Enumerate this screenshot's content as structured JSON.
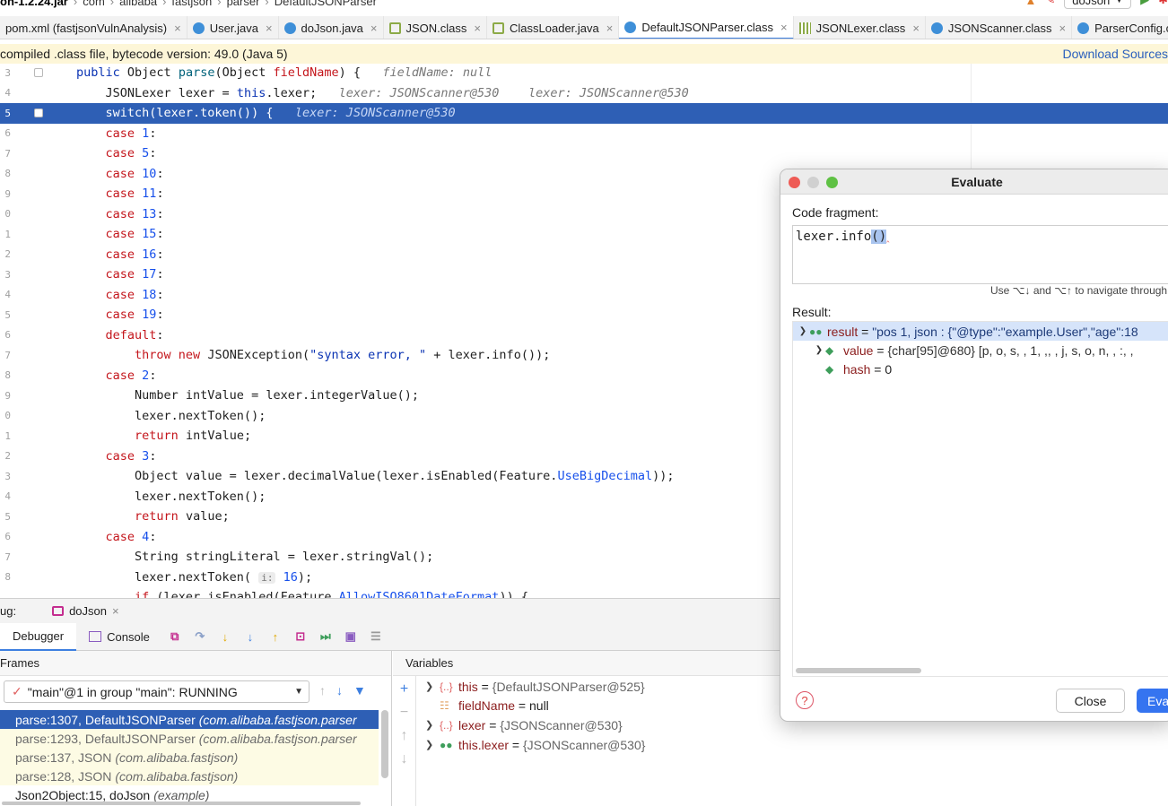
{
  "breadcrumb": {
    "items": [
      "on-1.2.24.jar",
      "com",
      "alibaba",
      "fastjson",
      "parser",
      "DefaultJSONParser"
    ]
  },
  "run_config": {
    "label": "doJson"
  },
  "tabs": [
    {
      "label": "pom.xml (fastjsonVulnAnalysis)",
      "icon": "xml-icon"
    },
    {
      "label": "User.java",
      "icon": "java-icon"
    },
    {
      "label": "doJson.java",
      "icon": "java-icon"
    },
    {
      "label": "JSON.class",
      "icon": "class-icon"
    },
    {
      "label": "ClassLoader.java",
      "icon": "class-icon"
    },
    {
      "label": "DefaultJSONParser.class",
      "icon": "java-icon"
    },
    {
      "label": "JSONLexer.class",
      "icon": "interface-icon"
    },
    {
      "label": "JSONScanner.class",
      "icon": "java-icon"
    },
    {
      "label": "ParserConfig.class",
      "icon": "java-icon"
    }
  ],
  "notice": {
    "text": "compiled .class file, bytecode version: 49.0 (Java 5)",
    "link": "Download Sources"
  },
  "editor": {
    "line_numbers": [
      "3",
      "4",
      "5",
      "6",
      "7",
      "8",
      "9",
      "0",
      "1",
      "2",
      "3",
      "4",
      "5",
      "6",
      "7",
      "8",
      "9",
      "0",
      "1",
      "2",
      "3",
      "4",
      "5",
      "6",
      "7",
      "8"
    ],
    "hints": {
      "l0": "fieldName: null",
      "l1a": "lexer: JSONScanner@530",
      "l1b": "lexer: JSONScanner@530",
      "l2": "lexer: JSONScanner@530",
      "param": "i:"
    }
  },
  "debug": {
    "label": "ug:",
    "session": "doJson",
    "tabs": {
      "debugger": "Debugger",
      "console": "Console"
    },
    "frames_title": "Frames",
    "thread": "\"main\"@1 in group \"main\": RUNNING",
    "frames": [
      {
        "method": "parse:1307, DefaultJSONParser",
        "pkg": "(com.alibaba.fastjson.parser"
      },
      {
        "method": "parse:1293, DefaultJSONParser",
        "pkg": "(com.alibaba.fastjson.parser"
      },
      {
        "method": "parse:137, JSON",
        "pkg": "(com.alibaba.fastjson)"
      },
      {
        "method": "parse:128, JSON",
        "pkg": "(com.alibaba.fastjson)"
      },
      {
        "method": "Json2Object:15, doJson",
        "pkg": "(example)"
      }
    ],
    "variables_title": "Variables",
    "variables": [
      {
        "name": "this",
        "value": "{DefaultJSONParser@525}"
      },
      {
        "name": "fieldName",
        "value": "null"
      },
      {
        "name": "lexer",
        "value": "{JSONScanner@530}"
      },
      {
        "name": "this.lexer",
        "value": "{JSONScanner@530}"
      }
    ]
  },
  "evaluate": {
    "title": "Evaluate",
    "code_label": "Code fragment:",
    "code_prefix": "lexer.info",
    "code_selected": "()",
    "nav_hint": "Use ⌥↓ and ⌥↑ to navigate through",
    "result_label": "Result:",
    "results": [
      {
        "name": "result",
        "value": "\"pos 1, json : {\"@type\":\"example.User\",\"age\":18"
      },
      {
        "name": "value",
        "value": "{char[95]@680} [p, o, s,  , 1, ,,  , j, s, o, n,  , :,  ,"
      },
      {
        "name": "hash",
        "value": "0"
      }
    ],
    "close_label": "Close",
    "evaluate_label": "Eva",
    "help": "?"
  }
}
